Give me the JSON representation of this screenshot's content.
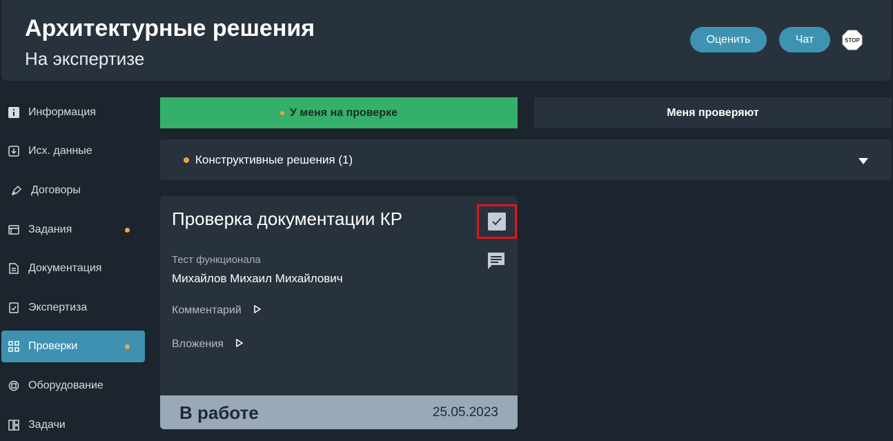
{
  "header": {
    "title": "Архитектурные решения",
    "subtitle": "На экспертизе",
    "rate_label": "Оценить",
    "chat_label": "Чат",
    "stop_label": "STOP"
  },
  "sidebar": {
    "items": [
      {
        "label": "Информация",
        "icon": "info-icon"
      },
      {
        "label": "Исх. данные",
        "icon": "download-icon"
      },
      {
        "label": "Договоры",
        "icon": "pen-icon"
      },
      {
        "label": "Задания",
        "icon": "tasks-window-icon",
        "badge": true
      },
      {
        "label": "Документация",
        "icon": "document-icon"
      },
      {
        "label": "Экспертиза",
        "icon": "expertise-icon"
      },
      {
        "label": "Проверки",
        "icon": "grid-icon",
        "badge": true,
        "active": true
      },
      {
        "label": "Оборудование",
        "icon": "chip-icon"
      },
      {
        "label": "Задачи",
        "icon": "layout-icon"
      }
    ]
  },
  "tabs": {
    "mine": "У меня на проверке",
    "others": "Меня проверяют"
  },
  "group": {
    "label": "Конструктивные решения (1)"
  },
  "card": {
    "title": "Проверка документации КР",
    "subtitle": "Тест функционала",
    "person": "Михайлов Михаил Михайлович",
    "comment_label": "Комментарий",
    "attachments_label": "Вложения",
    "status": "В работе",
    "date": "25.05.2023"
  },
  "colors": {
    "accent": "#3f93b2",
    "active_tab": "#35b06a",
    "badge": "#f0a63b",
    "highlight": "#e0151c"
  }
}
